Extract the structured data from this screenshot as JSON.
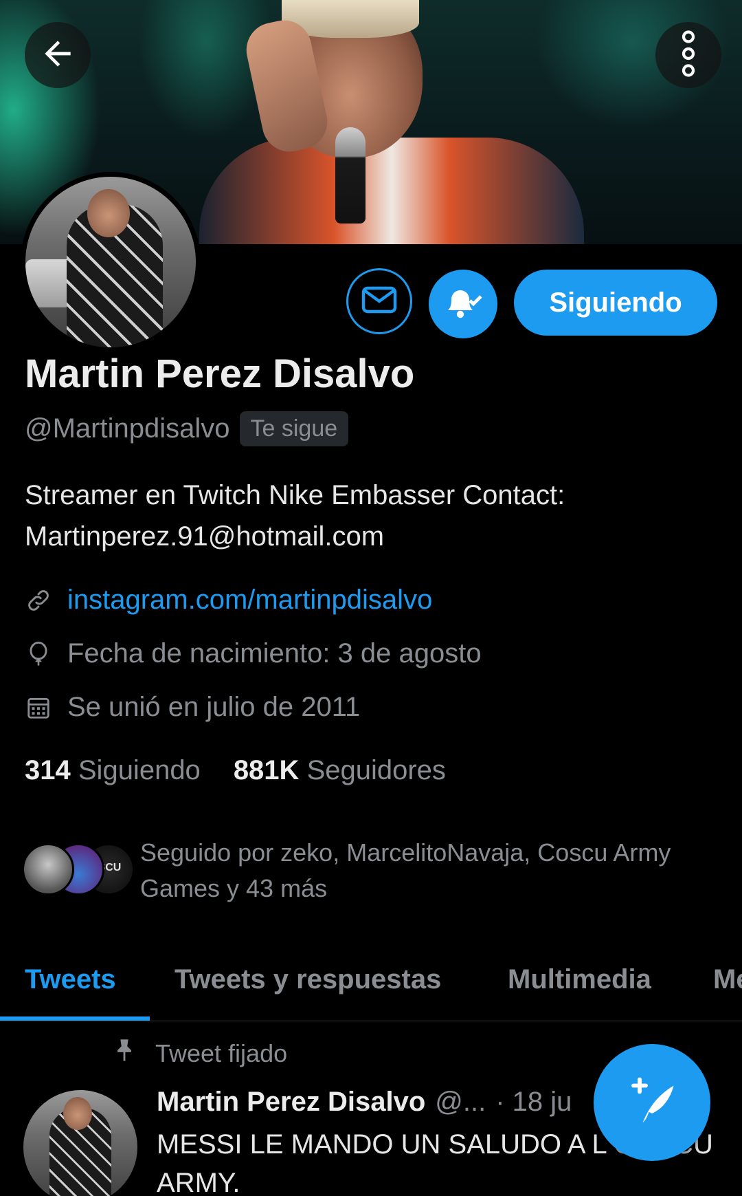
{
  "header": {
    "back_icon": "arrow-left-icon",
    "more_icon": "more-vertical-icon"
  },
  "profile": {
    "name": "Martin Perez Disalvo",
    "handle": "@Martinpdisalvo",
    "follows_you": "Te sigue",
    "bio": "Streamer en Twitch Nike Embasser Contact: Martinperez.91@hotmail.com",
    "website": "instagram.com/martinpdisalvo",
    "birthday": "Fecha de nacimiento: 3 de agosto",
    "joined": "Se unió en julio de 2011",
    "following_count": "314",
    "following_label": "Siguiendo",
    "followers_count": "881K",
    "followers_label": "Seguidores",
    "followed_by": "Seguido por zeko, MarcelitoNavaja, Coscu Army Games y 43 más"
  },
  "actions": {
    "message_icon": "mail-icon",
    "notifications_icon": "bell-check-icon",
    "follow_label": "Siguiendo"
  },
  "tabs": [
    {
      "label": "Tweets",
      "active": true
    },
    {
      "label": "Tweets y respuestas",
      "active": false
    },
    {
      "label": "Multimedia",
      "active": false
    },
    {
      "label": "Me",
      "active": false
    }
  ],
  "pinned_tweet": {
    "label": "Tweet fijado",
    "author": "Martin Perez Disalvo",
    "handle": "@...",
    "date": "· 18 ju",
    "text": "MESSI LE MANDO UN SALUDO A L COSCU ARMY."
  },
  "fab": {
    "icon": "compose-tweet-icon"
  },
  "colors": {
    "accent": "#1d9bf0",
    "background": "#000000",
    "muted_text": "#8a8d91"
  }
}
